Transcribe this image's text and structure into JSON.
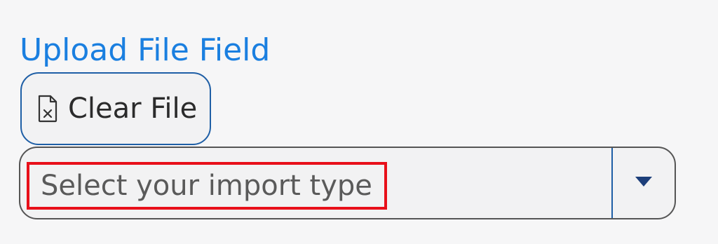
{
  "upload_field": {
    "label": "Upload File Field",
    "clear_button_label": "Clear File",
    "clear_button_icon": "file-x-icon"
  },
  "import_select": {
    "placeholder": "Select your import type",
    "arrow_icon": "caret-down-icon",
    "highlight_color": "#e8101a"
  },
  "colors": {
    "label_blue": "#1a7fe0",
    "border_blue": "#1f5fa6",
    "arrow_navy": "#1d3f7a"
  }
}
